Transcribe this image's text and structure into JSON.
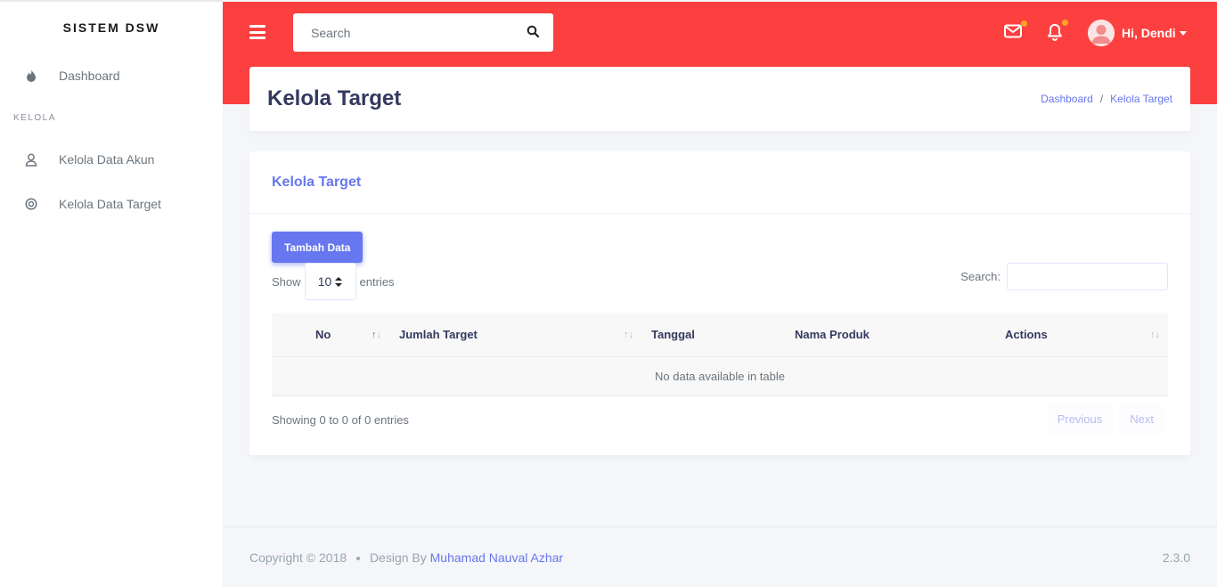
{
  "sidebar": {
    "brand": "SISTEM DSW",
    "dashboard": "Dashboard",
    "section_header": "KELOLA",
    "items": [
      {
        "label": "Kelola Data Akun",
        "icon": "user-icon"
      },
      {
        "label": "Kelola Data Target",
        "icon": "target-icon"
      }
    ]
  },
  "topbar": {
    "search_placeholder": "Search",
    "greeting": "Hi, Dendi",
    "accent_color": "#fc4040"
  },
  "header": {
    "title": "Kelola Target",
    "breadcrumb": [
      "Dashboard",
      "Kelola Target"
    ]
  },
  "card": {
    "title": "Kelola Target",
    "add_button": "Tambah Data",
    "show_label": "Show",
    "show_value": "10",
    "entries_label": "entries",
    "search_label": "Search:",
    "columns": [
      "No",
      "Jumlah Target",
      "Tanggal",
      "Nama Produk",
      "Actions"
    ],
    "empty_message": "No data available in table",
    "info": "Showing 0 to 0 of 0 entries",
    "prev": "Previous",
    "next": "Next"
  },
  "footer": {
    "copyright": "Copyright © 2018",
    "design_by": "Design By",
    "author": "Muhamad Nauval Azhar",
    "version": "2.3.0"
  }
}
